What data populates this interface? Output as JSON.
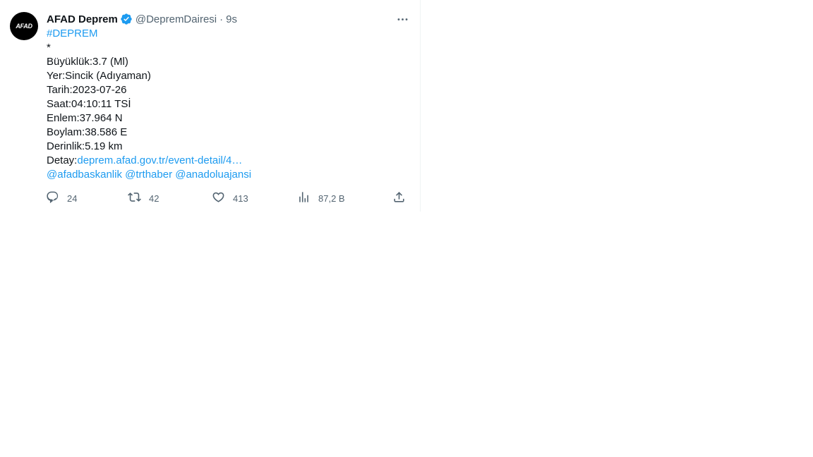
{
  "colors": {
    "text": "#0f1419",
    "muted": "#536471",
    "link": "#1d9bf0",
    "verified_badge": "#1d9bf0",
    "avatar_bg": "#000000"
  },
  "tweet": {
    "avatar_text": "AFAD",
    "display_name": "AFAD Deprem",
    "verified_icon": "verified-badge-icon",
    "handle": "@DepremDairesi",
    "separator": "·",
    "time": "9s",
    "more_icon": "more-options-icon",
    "hashtag": "#DEPREM",
    "asterisk": "*",
    "lines": {
      "magnitude": "Büyüklük:3.7 (Ml)",
      "place": "Yer:Sincik (Adıyaman)",
      "date": "Tarih:2023-07-26",
      "time": "Saat:04:10:11 TSİ",
      "latitude": "Enlem:37.964 N",
      "longitude": "Boylam:38.586 E",
      "depth": "Derinlik:5.19 km"
    },
    "detail_label": "Detay:",
    "detail_link": "deprem.afad.gov.tr/event-detail/4…",
    "mentions": [
      "@afadbaskanlik",
      "@trthaber",
      "@anadoluajansi"
    ]
  },
  "actions": {
    "reply": {
      "icon": "reply-icon",
      "count": "24"
    },
    "retweet": {
      "icon": "retweet-icon",
      "count": "42"
    },
    "like": {
      "icon": "heart-icon",
      "count": "413"
    },
    "views": {
      "icon": "views-chart-icon",
      "count": "87,2 B"
    },
    "share": {
      "icon": "share-icon"
    }
  }
}
